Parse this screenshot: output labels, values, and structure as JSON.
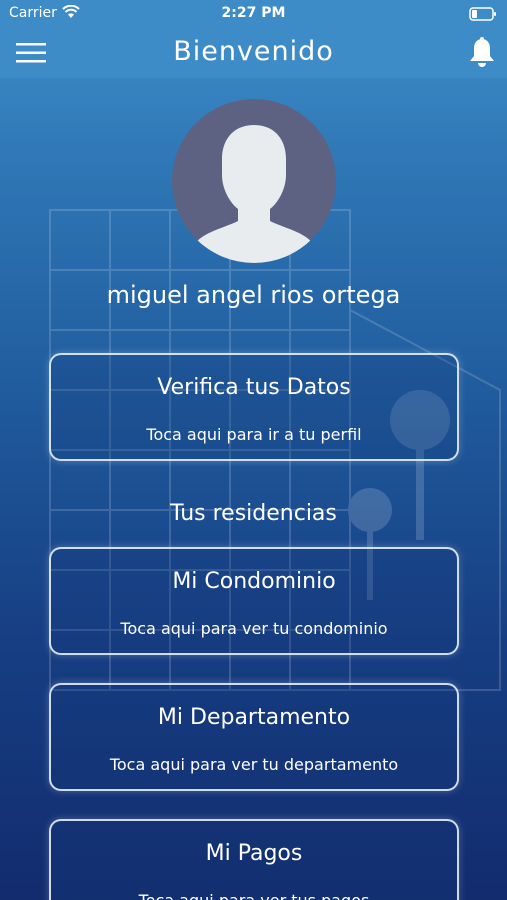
{
  "status_bar": {
    "carrier": "Carrier",
    "time": "2:27 PM"
  },
  "nav": {
    "title": "Bienvenido"
  },
  "user": {
    "name": "miguel angel rios ortega"
  },
  "cards": {
    "verify": {
      "title": "Verifica tus Datos",
      "subtitle": "Toca aqui para ir a tu perfil"
    },
    "condominio": {
      "title": "Mi Condominio",
      "subtitle": "Toca aqui para ver tu condominio"
    },
    "departamento": {
      "title": "Mi Departamento",
      "subtitle": "Toca aqui para ver tu departamento"
    },
    "pagos": {
      "title": "Mi Pagos",
      "subtitle": "Toca aqui para ver tus pagos"
    }
  },
  "section": {
    "residencias": "Tus residencias"
  },
  "colors": {
    "nav_bg": "#3d8cc8",
    "avatar_bg": "#5e6282",
    "text": "#ffffff"
  },
  "icons": [
    "menu-icon",
    "wifi-icon",
    "battery-icon",
    "bell-icon",
    "user-silhouette-icon"
  ]
}
